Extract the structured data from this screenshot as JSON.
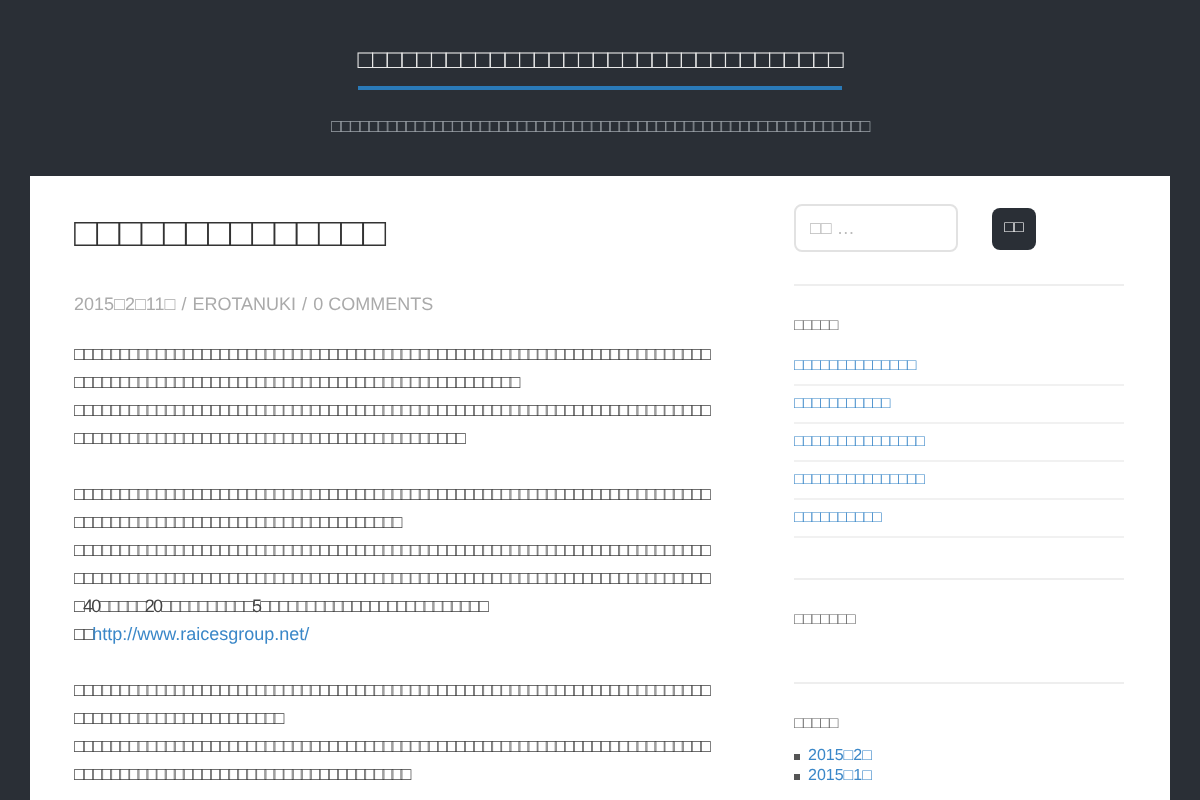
{
  "site": {
    "title": "□□□□□□□□□□□□□□□□□□□□□□□□□□□□□□□□□",
    "tagline": "□□□□□□□□□□□□□□□□□□□□□□□□□□□□□□□□□□□□□□□□□□□□□□□□□□□□□□□□□□"
  },
  "post": {
    "title": "□□□□□□□□□□□□□□",
    "date": "2015□2□11□",
    "sep1": "/",
    "author": "EROTANUKI",
    "sep2": "/",
    "comments": "0 COMMENTS",
    "paragraphs": [
      [
        {
          "kind": "text",
          "text": "□□□□□□□□□□□□□□□□□□□□□□□□□□□□□□□□□□□□□□□□□□□□□□□□□□□□□□□□□□□□□□□□□□□□□□□□□□□□□□□□□□□□□□□□□□□□□□□□□□□□□□□□□□□□□□□□□□□□□□□"
        },
        {
          "kind": "text",
          "text": "□□□□□□□□□□□□□□□□□□□□□□□□□□□□□□□□□□□□□□□□□□□□□□□□□□□□□□□□□□□□□□□□□□□□□□□□□□□□□□□□□□□□□□□□□□□□□□□□□□□□□□□□□□□□□□□□□"
        }
      ],
      [
        {
          "kind": "text",
          "text": "□□□□□□□□□□□□□□□□□□□□□□□□□□□□□□□□□□□□□□□□□□□□□□□□□□□□□□□□□□□□□□□□□□□□□□□□□□□□□□□□□□□□□□□□□□□□□□□□□□□□□□□□□□"
        },
        {
          "kind": "text",
          "text": "□□□□□□□□□□□□□□□□□□□□□□□□□□□□□□□□□□□□□□□□□□□□□□□□□□□□□□□□□□□□□□□□□□□□□□□□□□□□□□□□□□□□□□□□□□□□□□□□□□□□□□□□□□□□□□□□□□□□□□□□□□□□□□□□□□□□□□□□□□□□□40□□□□□20□□□□□□□□□□5□□□□□□□□□□□□□□□□□□□□□□□□□"
        },
        {
          "kind": "link",
          "prefix": "□□",
          "link": "http://www.raicesgroup.net/"
        }
      ],
      [
        {
          "kind": "text",
          "text": "□□□□□□□□□□□□□□□□□□□□□□□□□□□□□□□□□□□□□□□□□□□□□□□□□□□□□□□□□□□□□□□□□□□□□□□□□□□□□□□□□□□□□□□□□□□□□"
        },
        {
          "kind": "text",
          "text": "□□□□□□□□□□□□□□□□□□□□□□□□□□□□□□□□□□□□□□□□□□□□□□□□□□□□□□□□□□□□□□□□□□□□□□□□□□□□□□□□□□□□□□□□□□□□□□□□□□□□□□□□□□□"
        }
      ]
    ]
  },
  "sidebar": {
    "search": {
      "placeholder": "□□ …",
      "button": "□□"
    },
    "widgets": [
      {
        "heading": "□□□□□",
        "links": [
          "□□□□□□□□□□□□□□",
          "□□□□□□□□□□□",
          "□□□□□□□□□□□□□□□",
          "□□□□□□□□□□□□□□□",
          "□□□□□□□□□□"
        ]
      },
      {
        "heading": "□□□□□□□"
      },
      {
        "heading": "□□□□□",
        "archives": [
          "2015□2□",
          "2015□1□"
        ]
      }
    ]
  }
}
